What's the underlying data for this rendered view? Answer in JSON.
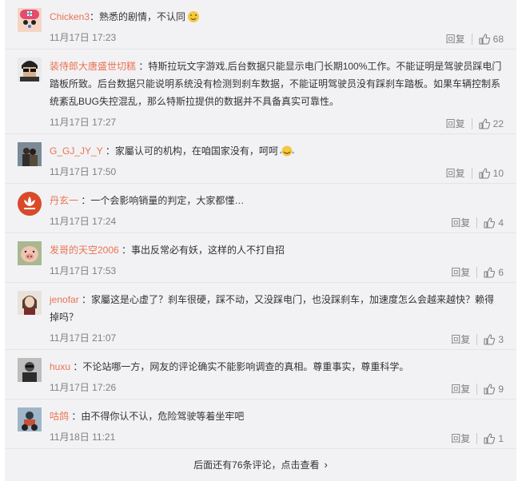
{
  "comments": [
    {
      "user": "Chicken3",
      "sep": "：",
      "text": "熟悉的剧情，不认同",
      "time": "11月17日 17:23",
      "reply": "回复",
      "likes": "68",
      "avatar": "chopper-avatar",
      "emoji": "wink-emoji"
    },
    {
      "user": "装侍郎大唐盛世切糕",
      "sep": " ：",
      "text": "特斯拉玩文字游戏,后台数据只能显示电门长期100%工作。不能证明是驾驶员踩电门踏板所致。后台数据只能说明系统没有检测到刹车数据，不能证明驾驶员没有踩刹车踏板。如果车辆控制系统紊乱BUG失控混乱，那么特斯拉提供的数据并不具备真实可靠性。",
      "time": "11月17日 17:27",
      "reply": "回复",
      "likes": "22",
      "avatar": "sunglasses-avatar"
    },
    {
      "user": "G_GJ_JY_Y",
      "sep": " ：",
      "text": "家屬认可的机构，在咱国家没有，呵呵",
      "time": "11月17日 17:50",
      "reply": "回复",
      "likes": "10",
      "avatar": "couple-avatar",
      "emoji": "smile-emoji"
    },
    {
      "user": "丹玄一",
      "sep": " ：",
      "text": "一个会影响销量的判定，大家都懂…",
      "time": "11月17日 17:24",
      "reply": "回复",
      "likes": "4",
      "avatar": "lotus-avatar"
    },
    {
      "user": "发哥的天空2006",
      "sep": " ：",
      "text": "事出反常必有妖，这样的人不打自招",
      "time": "11月17日 17:53",
      "reply": "回复",
      "likes": "6",
      "avatar": "pig-avatar"
    },
    {
      "user": "jenofar",
      "sep": " ：",
      "text": "家屬这是心虚了？刹车很硬，踩不动，又没踩电门，也没踩刹车，加速度怎么会越来越快？赖得掉吗？",
      "time": "11月17日 21:07",
      "reply": "回复",
      "likes": "3",
      "avatar": "woman-avatar"
    },
    {
      "user": "huxu",
      "sep": " ：",
      "text": "不论站哪一方，网友的评论确实不能影响调查的真相。尊重事实，尊重科学。",
      "time": "11月17日 17:26",
      "reply": "回复",
      "likes": "9",
      "avatar": "man-avatar"
    },
    {
      "user": "咕鸽",
      "sep": " ：",
      "text": "由不得你认不认，危险驾驶等着坐牢吧",
      "time": "11月18日 11:21",
      "reply": "回复",
      "likes": "1",
      "avatar": "rider-avatar"
    }
  ],
  "more_label": "后面还有76条评论，点击查看",
  "colors": {
    "username": "#eb7350",
    "background": "#f2f2f5",
    "meta": "#808080"
  }
}
